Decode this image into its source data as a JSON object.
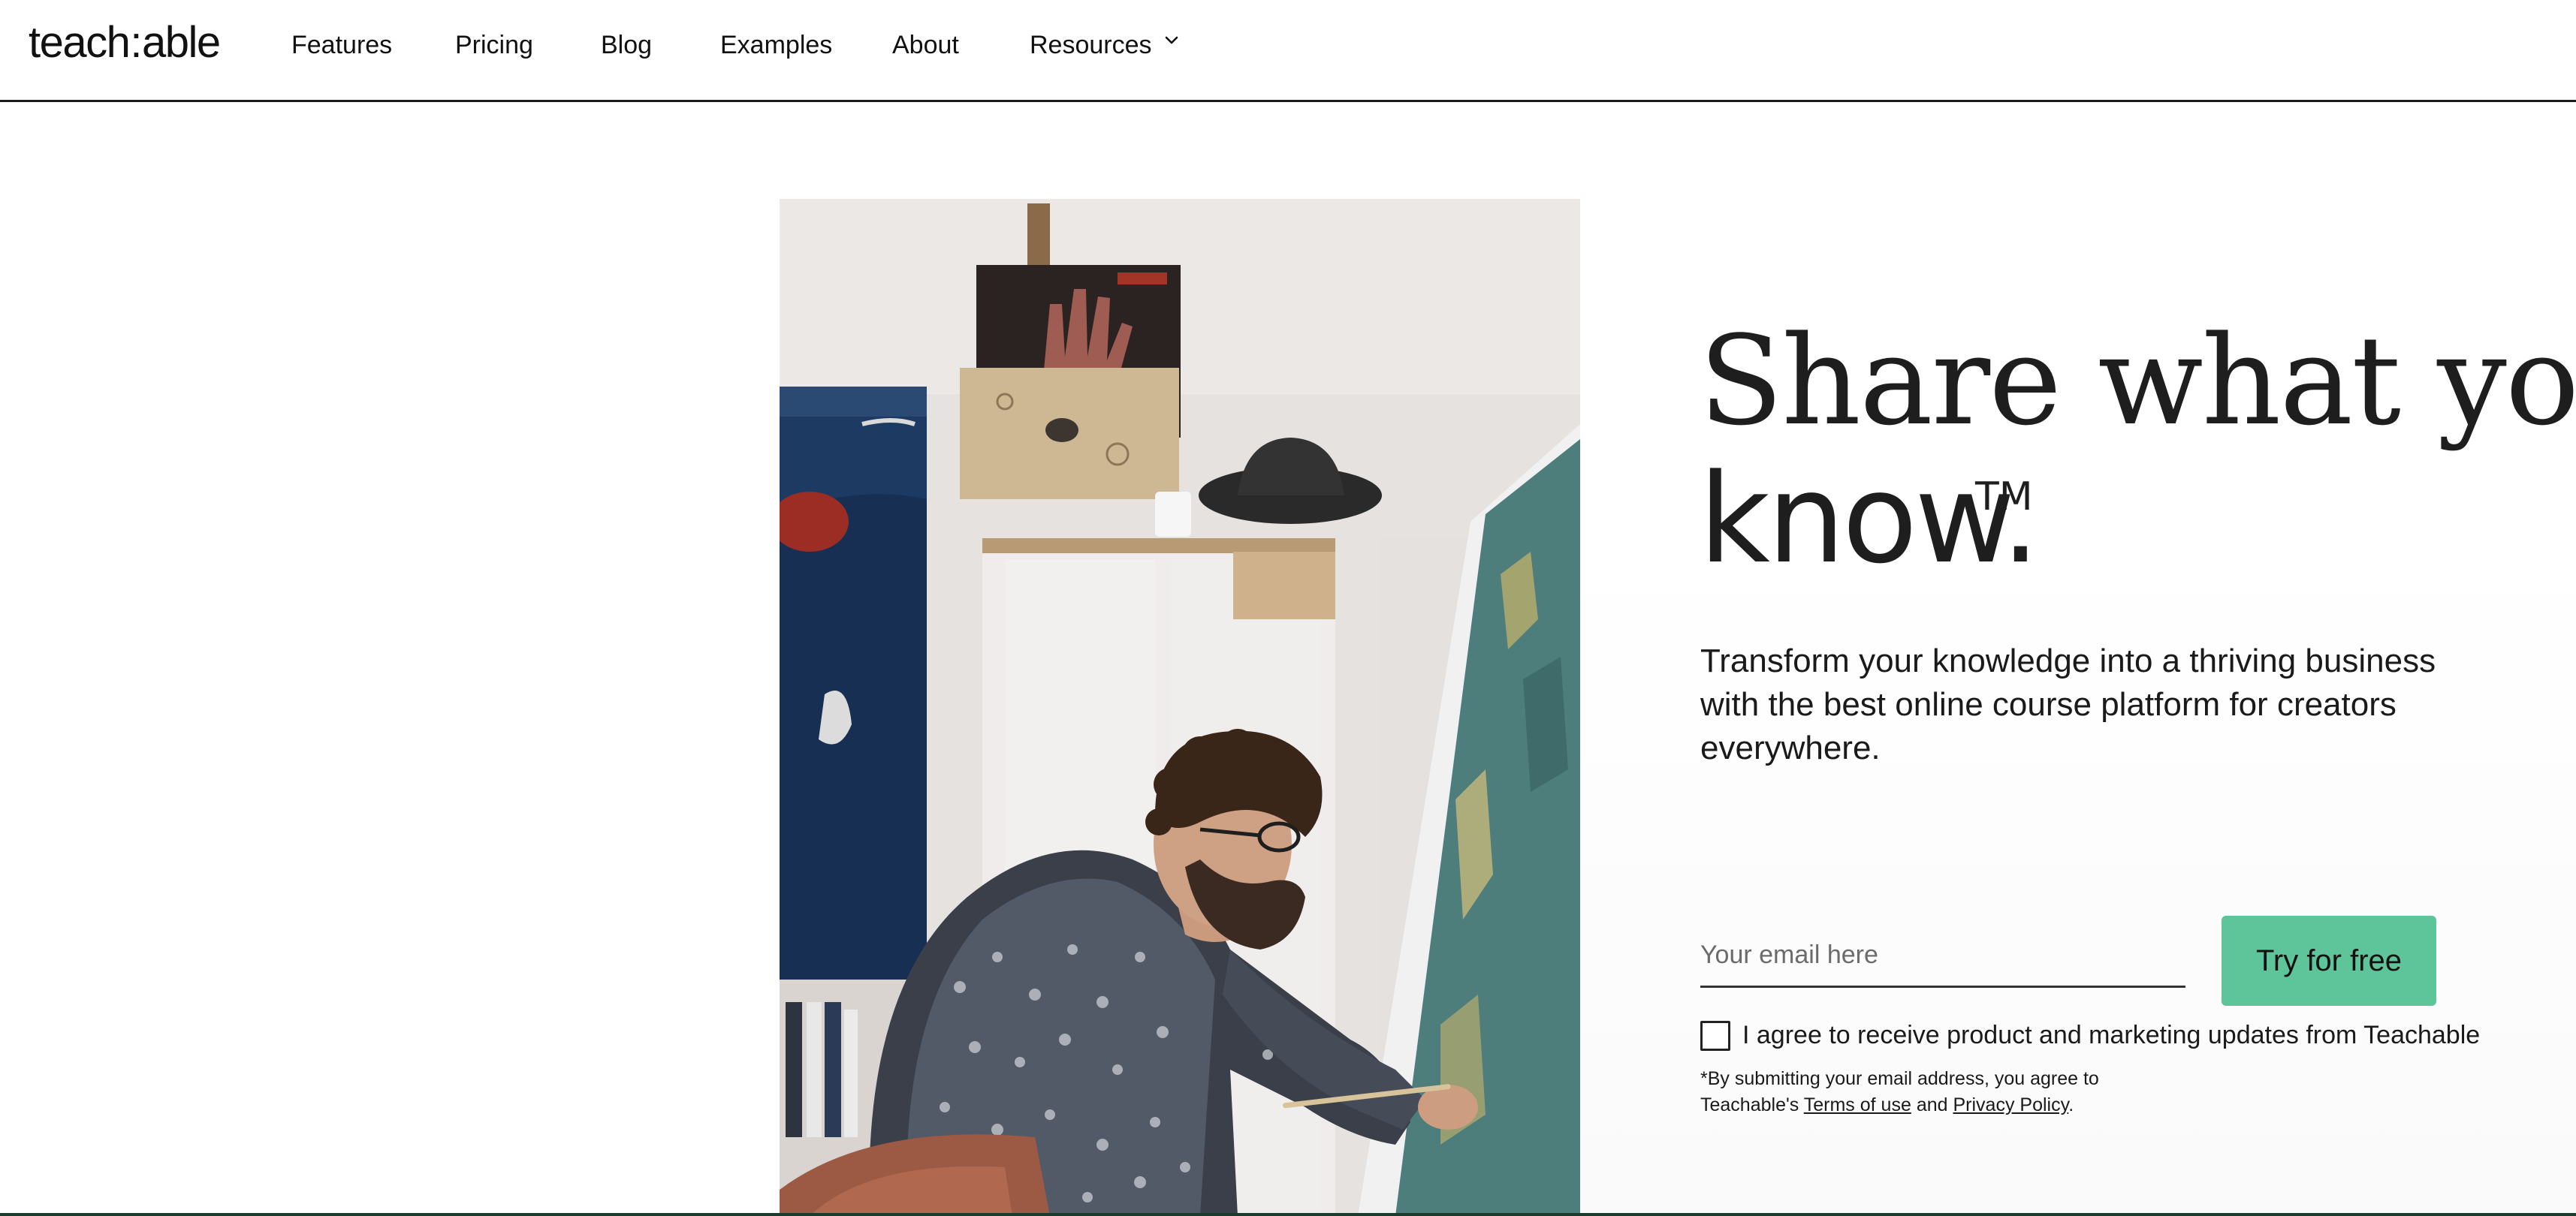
{
  "nav": {
    "logo": {
      "left": "teach",
      "colon": ":",
      "right": "able"
    },
    "items": [
      {
        "label": "Features"
      },
      {
        "label": "Pricing"
      },
      {
        "label": "Blog"
      },
      {
        "label": "Examples"
      },
      {
        "label": "About"
      },
      {
        "label": "Resources"
      }
    ],
    "resources_icon": "chevron-down-icon"
  },
  "hero": {
    "headline_line1": "Share what you",
    "headline_line2": "know.",
    "trademark": "TM",
    "subtext": "Transform your knowledge into a thriving business with the best online course platform for creators everywhere.",
    "email_placeholder": "Your email here",
    "email_value": "",
    "cta_label": "Try for free",
    "consent_label": "I agree to receive product and marketing updates from Teachable",
    "consent_checked": false,
    "legal_prefix": "*By submitting your email address, you agree to Teachable's",
    "terms_link": "Terms of use",
    "legal_and": "and",
    "privacy_link": "Privacy Policy",
    "legal_suffix": "."
  },
  "colors": {
    "cta": "#5ec49a",
    "text": "#1a1a1a",
    "rule": "#1b1b1b"
  }
}
